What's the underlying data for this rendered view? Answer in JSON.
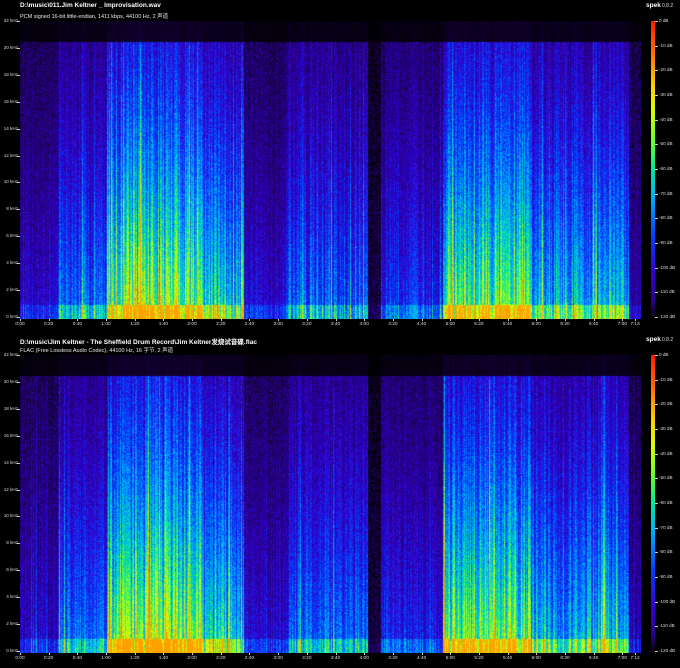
{
  "app": {
    "name": "spek",
    "version": "0.8.2"
  },
  "colors": {
    "background": "#000000",
    "text": "#ffffff"
  },
  "y_axis": {
    "labels": [
      "22 kHz",
      "20 kHz",
      "18 kHz",
      "16 kHz",
      "14 kHz",
      "12 kHz",
      "10 kHz",
      "8 kHz",
      "6 kHz",
      "4 kHz",
      "2 kHz",
      "0 kHz"
    ],
    "max_khz": 22
  },
  "x_axis_duration": "7:13",
  "db_scale": {
    "labels": [
      "0 dB",
      "-10 dB",
      "-20 dB",
      "-30 dB",
      "-40 dB",
      "-50 dB",
      "-60 dB",
      "-70 dB",
      "-80 dB",
      "-90 dB",
      "-100 dB",
      "-110 dB",
      "-120 dB"
    ]
  },
  "panes": [
    {
      "title": "D:\\music\\011.Jim Keltner _ Improvisation.wav",
      "info": "PCM signed 16-bit little-endian, 1411 kbps, 44100 Hz, 2 声道",
      "time_labels": [
        "0:00",
        "0:20",
        "0:40",
        "1:00",
        "1:20",
        "1:40",
        "2:00",
        "2:20",
        "2:40",
        "3:00",
        "3:20",
        "3:40",
        "4:00",
        "4:20",
        "4:40",
        "5:00",
        "5:20",
        "5:40",
        "6:00",
        "6:20",
        "6:40",
        "7:00",
        "7:13"
      ]
    },
    {
      "title": "D:\\music\\Jim Keltner - The Sheffield Drum Record\\Jim Keltner发烧试音碟.flac",
      "info": "FLAC (Free Lossless Audio Codec), 44100 Hz, 16 字节, 2 声道",
      "time_labels": [
        "0:00",
        "0:20",
        "0:40",
        "1:00",
        "1:20",
        "1:40",
        "2:00",
        "2:20",
        "2:40",
        "3:00",
        "3:20",
        "3:40",
        "4:00",
        "4:20",
        "4:40",
        "5:00",
        "5:20",
        "5:40",
        "6:00",
        "6:20",
        "6:40",
        "7:00",
        "7:12"
      ]
    }
  ]
}
